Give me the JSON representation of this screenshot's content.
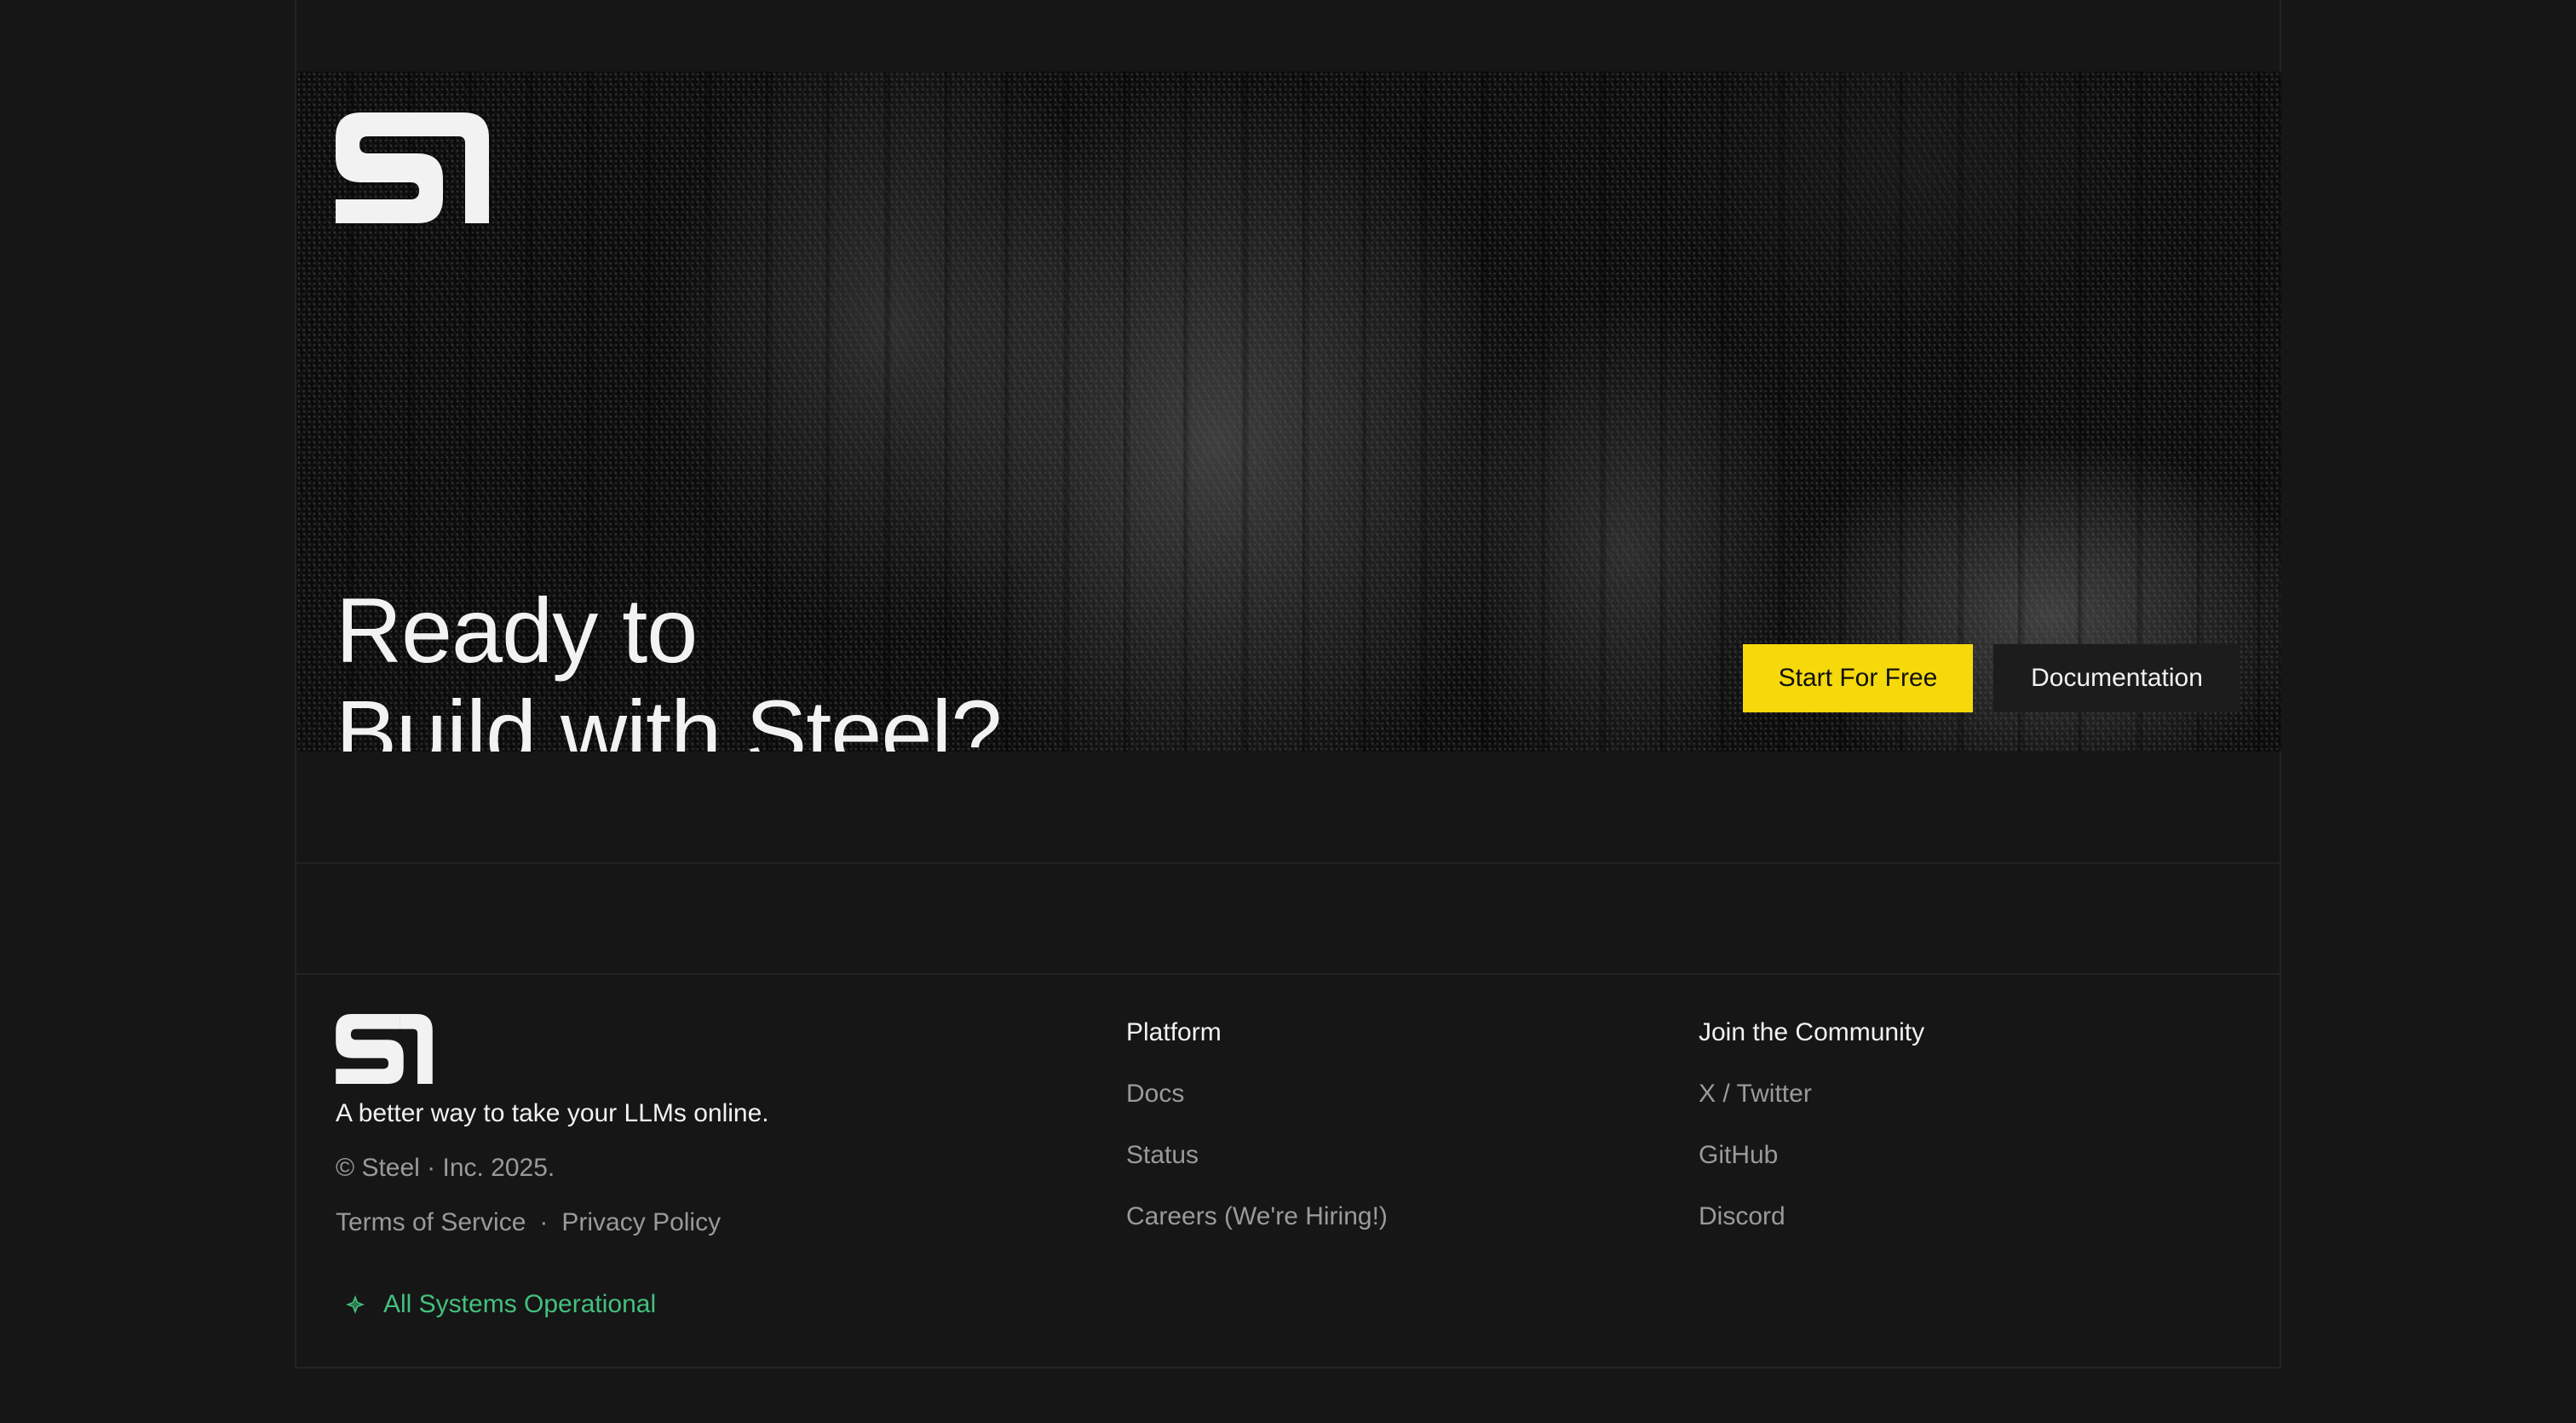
{
  "hero": {
    "title_line1": "Ready to",
    "title_line2": "Build with Steel?",
    "primary_button": "Start For Free",
    "secondary_button": "Documentation"
  },
  "footer": {
    "tagline": "A better way to take your LLMs online.",
    "copyright": "© Steel · Inc. 2025.",
    "terms": "Terms of Service",
    "separator": "·",
    "privacy": "Privacy Policy",
    "status": "All Systems Operational",
    "columns": [
      {
        "title": "Platform",
        "links": [
          "Docs",
          "Status",
          "Careers (We're Hiring!)"
        ]
      },
      {
        "title": "Join the Community",
        "links": [
          "X / Twitter",
          "GitHub",
          "Discord"
        ]
      }
    ]
  },
  "colors": {
    "background": "#161616",
    "accent_yellow": "#f5d90a",
    "status_green": "#44c07e",
    "muted_text": "#9a9a9a"
  },
  "icons": {
    "logo": "steel-logo-icon",
    "status": "status-diamond-icon"
  }
}
